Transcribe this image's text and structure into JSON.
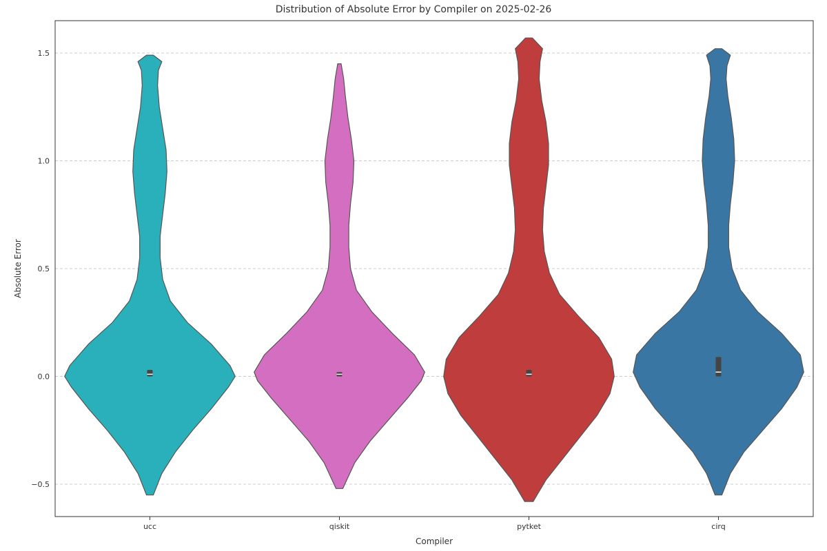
{
  "chart_data": {
    "type": "violin",
    "title": "Distribution of Absolute Error by Compiler on 2025-02-26",
    "xlabel": "Compiler",
    "ylabel": "Absolute Error",
    "ylim": [
      -0.65,
      1.65
    ],
    "yticks": [
      -0.5,
      0.0,
      0.5,
      1.0,
      1.5
    ],
    "ytick_labels": [
      "−0.5",
      "0.0",
      "0.5",
      "1.0",
      "1.5"
    ],
    "categories": [
      "ucc",
      "qiskit",
      "pytket",
      "cirq"
    ],
    "series": [
      {
        "name": "ucc",
        "color": "#2ab0ba",
        "range": [
          -0.55,
          1.49
        ],
        "median": 0.01,
        "q1": 0.0,
        "q3": 0.03,
        "profile": [
          {
            "y": -0.55,
            "w": 0.04
          },
          {
            "y": -0.45,
            "w": 0.14
          },
          {
            "y": -0.35,
            "w": 0.3
          },
          {
            "y": -0.25,
            "w": 0.5
          },
          {
            "y": -0.15,
            "w": 0.72
          },
          {
            "y": -0.05,
            "w": 0.92
          },
          {
            "y": 0.0,
            "w": 1.0
          },
          {
            "y": 0.05,
            "w": 0.94
          },
          {
            "y": 0.15,
            "w": 0.72
          },
          {
            "y": 0.25,
            "w": 0.44
          },
          {
            "y": 0.35,
            "w": 0.24
          },
          {
            "y": 0.45,
            "w": 0.15
          },
          {
            "y": 0.55,
            "w": 0.12
          },
          {
            "y": 0.65,
            "w": 0.12
          },
          {
            "y": 0.75,
            "w": 0.15
          },
          {
            "y": 0.85,
            "w": 0.18
          },
          {
            "y": 0.95,
            "w": 0.2
          },
          {
            "y": 1.05,
            "w": 0.19
          },
          {
            "y": 1.15,
            "w": 0.15
          },
          {
            "y": 1.25,
            "w": 0.11
          },
          {
            "y": 1.35,
            "w": 0.09
          },
          {
            "y": 1.42,
            "w": 0.1
          },
          {
            "y": 1.46,
            "w": 0.14
          },
          {
            "y": 1.49,
            "w": 0.04
          }
        ]
      },
      {
        "name": "qiskit",
        "color": "#d46ec0",
        "range": [
          -0.52,
          1.45
        ],
        "median": 0.01,
        "q1": 0.0,
        "q3": 0.02,
        "profile": [
          {
            "y": -0.52,
            "w": 0.04
          },
          {
            "y": -0.4,
            "w": 0.18
          },
          {
            "y": -0.3,
            "w": 0.36
          },
          {
            "y": -0.2,
            "w": 0.58
          },
          {
            "y": -0.1,
            "w": 0.8
          },
          {
            "y": -0.02,
            "w": 0.96
          },
          {
            "y": 0.02,
            "w": 1.0
          },
          {
            "y": 0.1,
            "w": 0.88
          },
          {
            "y": 0.2,
            "w": 0.62
          },
          {
            "y": 0.3,
            "w": 0.38
          },
          {
            "y": 0.4,
            "w": 0.2
          },
          {
            "y": 0.5,
            "w": 0.13
          },
          {
            "y": 0.6,
            "w": 0.11
          },
          {
            "y": 0.7,
            "w": 0.11
          },
          {
            "y": 0.8,
            "w": 0.13
          },
          {
            "y": 0.9,
            "w": 0.16
          },
          {
            "y": 1.0,
            "w": 0.17
          },
          {
            "y": 1.1,
            "w": 0.14
          },
          {
            "y": 1.2,
            "w": 0.1
          },
          {
            "y": 1.3,
            "w": 0.07
          },
          {
            "y": 1.38,
            "w": 0.05
          },
          {
            "y": 1.45,
            "w": 0.02
          }
        ]
      },
      {
        "name": "pytket",
        "color": "#c03d3e",
        "range": [
          -0.58,
          1.57
        ],
        "median": 0.01,
        "q1": 0.0,
        "q3": 0.03,
        "profile": [
          {
            "y": -0.58,
            "w": 0.05
          },
          {
            "y": -0.48,
            "w": 0.2
          },
          {
            "y": -0.38,
            "w": 0.4
          },
          {
            "y": -0.28,
            "w": 0.6
          },
          {
            "y": -0.18,
            "w": 0.8
          },
          {
            "y": -0.08,
            "w": 0.95
          },
          {
            "y": 0.0,
            "w": 1.0
          },
          {
            "y": 0.08,
            "w": 0.97
          },
          {
            "y": 0.18,
            "w": 0.82
          },
          {
            "y": 0.28,
            "w": 0.58
          },
          {
            "y": 0.38,
            "w": 0.36
          },
          {
            "y": 0.48,
            "w": 0.24
          },
          {
            "y": 0.58,
            "w": 0.18
          },
          {
            "y": 0.68,
            "w": 0.16
          },
          {
            "y": 0.78,
            "w": 0.17
          },
          {
            "y": 0.88,
            "w": 0.2
          },
          {
            "y": 0.98,
            "w": 0.23
          },
          {
            "y": 1.08,
            "w": 0.23
          },
          {
            "y": 1.18,
            "w": 0.2
          },
          {
            "y": 1.28,
            "w": 0.15
          },
          {
            "y": 1.38,
            "w": 0.12
          },
          {
            "y": 1.46,
            "w": 0.13
          },
          {
            "y": 1.52,
            "w": 0.16
          },
          {
            "y": 1.57,
            "w": 0.04
          }
        ]
      },
      {
        "name": "cirq",
        "color": "#3a76a3",
        "range": [
          -0.55,
          1.52
        ],
        "median": 0.02,
        "q1": 0.0,
        "q3": 0.09,
        "profile": [
          {
            "y": -0.55,
            "w": 0.04
          },
          {
            "y": -0.45,
            "w": 0.14
          },
          {
            "y": -0.35,
            "w": 0.3
          },
          {
            "y": -0.25,
            "w": 0.52
          },
          {
            "y": -0.15,
            "w": 0.74
          },
          {
            "y": -0.05,
            "w": 0.92
          },
          {
            "y": 0.02,
            "w": 1.0
          },
          {
            "y": 0.1,
            "w": 0.96
          },
          {
            "y": 0.2,
            "w": 0.74
          },
          {
            "y": 0.3,
            "w": 0.46
          },
          {
            "y": 0.4,
            "w": 0.26
          },
          {
            "y": 0.5,
            "w": 0.16
          },
          {
            "y": 0.6,
            "w": 0.12
          },
          {
            "y": 0.7,
            "w": 0.12
          },
          {
            "y": 0.8,
            "w": 0.14
          },
          {
            "y": 0.9,
            "w": 0.17
          },
          {
            "y": 1.0,
            "w": 0.19
          },
          {
            "y": 1.1,
            "w": 0.18
          },
          {
            "y": 1.2,
            "w": 0.15
          },
          {
            "y": 1.3,
            "w": 0.11
          },
          {
            "y": 1.38,
            "w": 0.09
          },
          {
            "y": 1.44,
            "w": 0.1
          },
          {
            "y": 1.49,
            "w": 0.14
          },
          {
            "y": 1.52,
            "w": 0.04
          }
        ]
      }
    ]
  }
}
